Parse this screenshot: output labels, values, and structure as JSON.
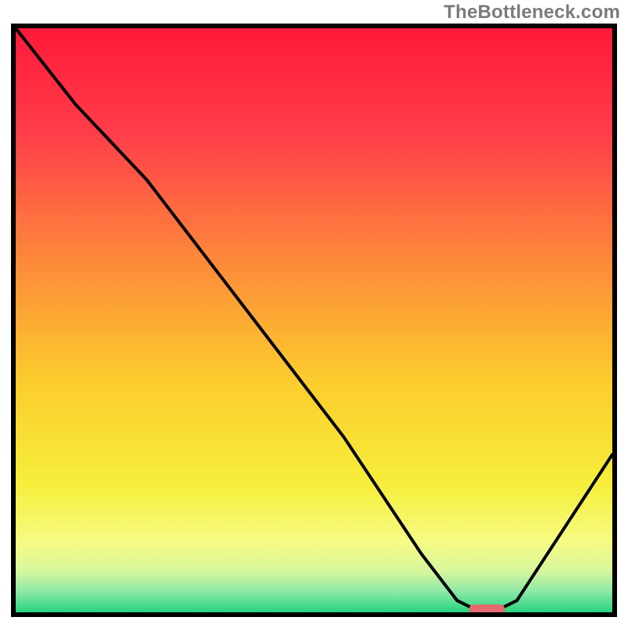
{
  "watermark": "TheBottleneck.com",
  "chart_data": {
    "type": "line",
    "title": "",
    "xlabel": "",
    "ylabel": "",
    "xlim": [
      0,
      100
    ],
    "ylim": [
      0,
      100
    ],
    "series": [
      {
        "name": "bottleneck-curve",
        "x": [
          0,
          10,
          22,
          40,
          55,
          68,
          74,
          78,
          80,
          84,
          100
        ],
        "y": [
          100,
          87,
          74,
          50,
          30,
          10,
          2,
          0,
          0,
          2,
          27
        ]
      }
    ],
    "marker": {
      "name": "optimal-segment",
      "x_start": 76,
      "x_end": 82,
      "y": 0,
      "color": "#e46a6f"
    },
    "background_gradient": {
      "stops": [
        {
          "offset": 0.0,
          "color": "#ff1a3a"
        },
        {
          "offset": 0.18,
          "color": "#ff3d4a"
        },
        {
          "offset": 0.4,
          "color": "#fd8a3a"
        },
        {
          "offset": 0.6,
          "color": "#fccb2d"
        },
        {
          "offset": 0.78,
          "color": "#f6ee3a"
        },
        {
          "offset": 0.88,
          "color": "#f6fb84"
        },
        {
          "offset": 0.93,
          "color": "#d6f79d"
        },
        {
          "offset": 0.965,
          "color": "#8be8a7"
        },
        {
          "offset": 1.0,
          "color": "#26d47e"
        }
      ]
    }
  }
}
